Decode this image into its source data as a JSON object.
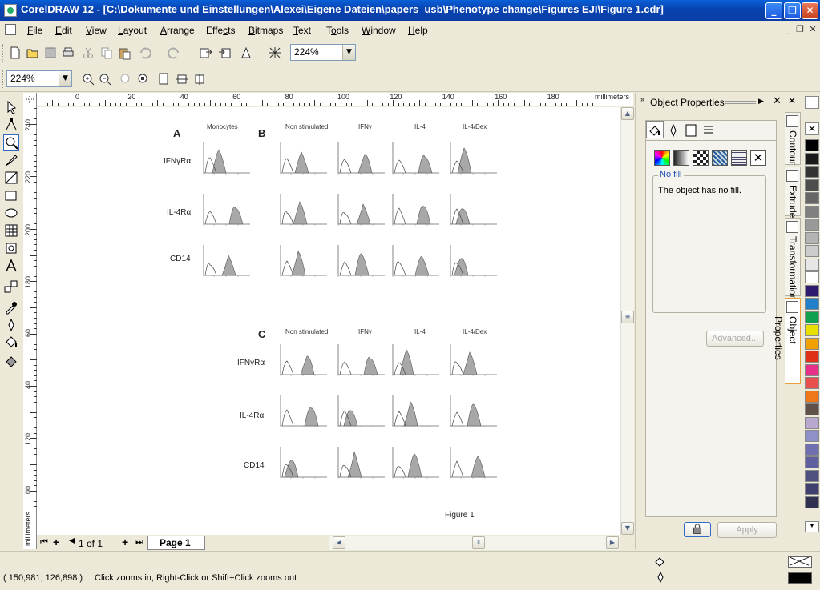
{
  "window": {
    "title": "CorelDRAW 12 - [C:\\Dokumente und Einstellungen\\Alexei\\Eigene Dateien\\papers_usb\\Phenotype change\\Figures EJI\\Figure 1.cdr]",
    "minimize": "_",
    "maximize": "❐",
    "close": "✕"
  },
  "menu": {
    "items": [
      {
        "label": "File",
        "key": "F"
      },
      {
        "label": "Edit",
        "key": "E"
      },
      {
        "label": "View",
        "key": "V"
      },
      {
        "label": "Layout",
        "key": "L"
      },
      {
        "label": "Arrange",
        "key": "A"
      },
      {
        "label": "Effects",
        "key": "C"
      },
      {
        "label": "Bitmaps",
        "key": "B"
      },
      {
        "label": "Text",
        "key": "T"
      },
      {
        "label": "Tools",
        "key": "O"
      },
      {
        "label": "Window",
        "key": "W"
      },
      {
        "label": "Help",
        "key": "H"
      }
    ]
  },
  "toolbar": {
    "zoom_combo": "224%",
    "zoom_combo2": "224%"
  },
  "ruler": {
    "unit": "millimeters",
    "h_ticks": [
      "0",
      "20",
      "40",
      "60",
      "80",
      "100",
      "120",
      "140",
      "160",
      "180"
    ],
    "v_ticks": [
      "240",
      "220",
      "200",
      "180",
      "160",
      "140",
      "120",
      "100"
    ],
    "v_unit": "millimeters"
  },
  "document": {
    "figure_title": "Figure 1",
    "panel_a_label": "A",
    "panel_b_label": "B",
    "panel_c_label": "C",
    "col_monocytes": "Monocytes",
    "columns": [
      "Non stimulated",
      "IFNγ",
      "IL-4",
      "IL-4/Dex"
    ],
    "rows": [
      "IFNγRα",
      "IL-4Rα",
      "CD14"
    ]
  },
  "pagenav": {
    "counter": "1 of 1",
    "tab": "Page 1"
  },
  "docker": {
    "title": "Object Properties",
    "group_label": "No fill",
    "fill_text": "The object has no fill.",
    "advanced_button": "Advanced...",
    "apply_button": "Apply"
  },
  "vtabs": [
    "Contour",
    "Extrude",
    "Transformation",
    "Object Properties"
  ],
  "palette": [
    "#ffffff",
    "#000000",
    "#1a1a1a",
    "#333333",
    "#4d4d4d",
    "#666666",
    "#808080",
    "#999999",
    "#b3b3b3",
    "#cccccc",
    "#e6e6e6",
    "#ffffff",
    "#2e1a6e",
    "#1f7fc8",
    "#10a050",
    "#e8e000",
    "#f0a000",
    "#e03018",
    "#e8308a",
    "#e85050",
    "#f07818",
    "#60504a",
    "#b8a8d0",
    "#9090c8",
    "#7070b0",
    "#6060a0",
    "#505080",
    "#404070",
    "#303050"
  ],
  "status": {
    "coords": "( 150,981; 126,898 )",
    "message": "Click zooms in, Right-Click or Shift+Click zooms out"
  }
}
